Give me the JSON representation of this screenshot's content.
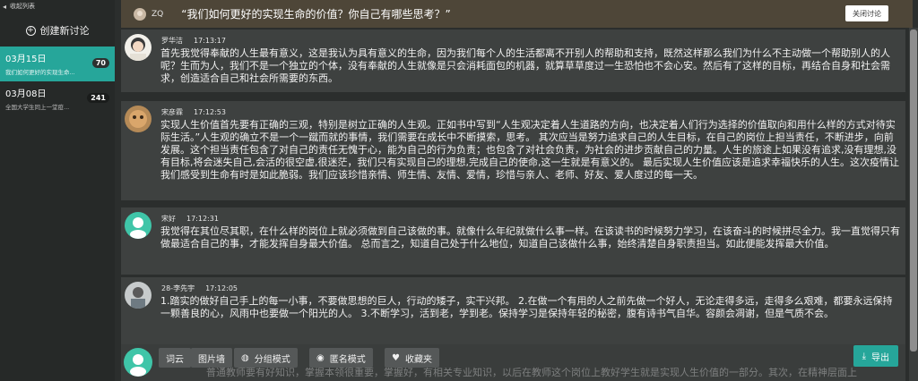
{
  "sidebar": {
    "collapse_label": "收起列表",
    "create_label": "创建新讨论",
    "items": [
      {
        "date": "03月15日",
        "title": "我们如何更好的实现生命...",
        "count": "70",
        "active": true
      },
      {
        "date": "03月08日",
        "title": "全国大学生同上一堂疫...",
        "count": "241",
        "active": false
      }
    ]
  },
  "header": {
    "user": "ZQ",
    "topic": "“我们如何更好的实现生命的价值？你自己有哪些思考？”",
    "close_label": "关闭讨论"
  },
  "posts": [
    {
      "author": "罗华洁",
      "time": "17:13:17",
      "text": "首先我觉得奉献的人生最有意义，这是我认为具有意义的生命，因为我们每个人的生活都离不开别人的帮助和支持，既然这样那么我们为什么不主动做一个帮助别人的人呢？生而为人，我们不是一个独立的个体，没有奉献的人生就像是只会消耗面包的机器，就算草草度过一生恐怕也不会心安。然后有了这样的目标，再结合自身和社会需求，创造适合自己和社会所需要的东西。"
    },
    {
      "author": "宋彦霖",
      "time": "17:12:53",
      "text": "实现人生价值首先要有正确的三观，特别是树立正确的人生观。正如书中写到“人生观决定着人生道路的方向，也决定着人们行为选择的价值取向和用什么样的方式对待实际生活。”人生观的确立不是一个一蹴而就的事情，我们需要在成长中不断摸索，思考。 其次应当是努力追求自己的人生目标，在自己的岗位上担当责任，不断进步，向前发展。这个担当责任包含了对自己的责任无愧于心，能为自己的行为负责；也包含了对社会负责，为社会的进步贡献自己的力量。人生的旅途上如果没有追求,没有理想,没有目标,将会迷失自己,会活的很空虚,很迷茫，我们只有实现自己的理想,完成自己的使命,这一生就是有意义的。 最后实现人生价值应该是追求幸福快乐的人生。这次疫情让我们感受到生命有时是如此脆弱。我们应该珍惜亲情、师生情、友情、爱情，珍惜与亲人、老师、好友、爱人度过的每一天。"
    },
    {
      "author": "宋好",
      "time": "17:12:31",
      "text": "我觉得在其位尽其职，在什么样的岗位上就必须做到自己该做的事。就像什么年纪就做什么事一样。在该读书的时候努力学习，在该奋斗的时候拼尽全力。我一直觉得只有做最适合自己的事，才能发挥自身最大价值。 总而言之，知道自己处于什么地位，知道自己该做什么事，始终清楚自身职责担当。如此便能发挥最大价值。"
    },
    {
      "author": "28-李先宇",
      "time": "17:12:05",
      "text": "1.踏实的做好自己手上的每一小事，不要做思想的巨人，行动的矮子，实干兴邦。 2.在做一个有用的人之前先做一个好人，无论走得多远，走得多么艰难，都要永远保持一颗善良的心，风雨中也要做一个阳光的人。 3.不断学习，活到老，学到老。保持学习是保持年轻的秘密，腹有诗书气自华。容颜会凋谢，但是气质不会。"
    }
  ],
  "footer": {
    "ghost_text": "普通教师要有好知识，掌握本领很重要，掌握好，有相关专业知识，以后在教师这个岗位上教好学生就是实现人生价值的一部分。其次，在精神层面上",
    "buttons": {
      "ciyun": "词云",
      "tupianqiang": "图片墙",
      "fenzu": "分组模式",
      "niming": "匿名模式",
      "shoucang": "收藏夹",
      "export": "导出"
    }
  },
  "colors": {
    "accent": "#26a69a",
    "header_bg": "#4e4638",
    "post_bg": "#3e4140"
  }
}
